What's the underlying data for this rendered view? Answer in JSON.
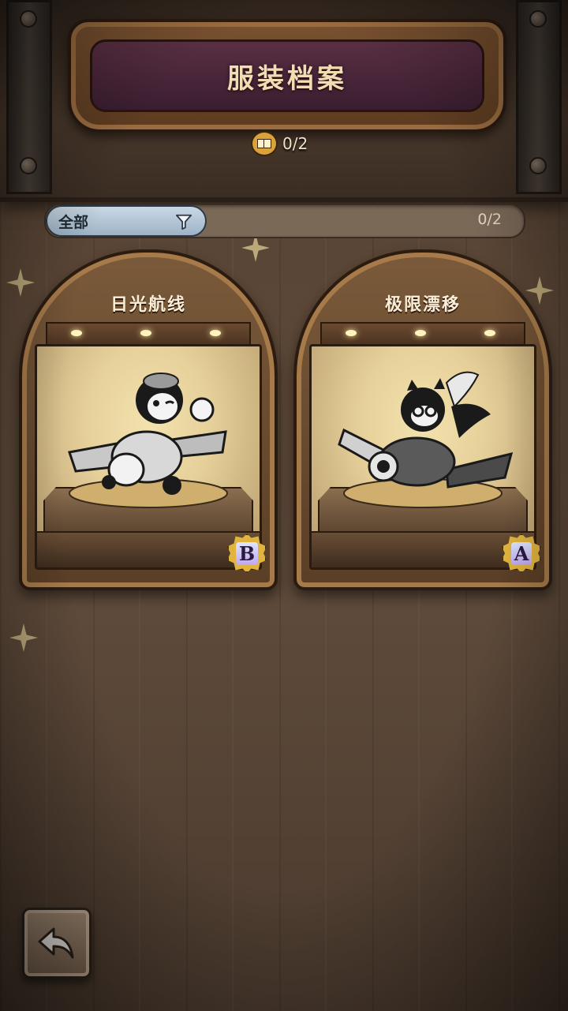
{
  "header": {
    "title": "服装档案",
    "collection_count": "0/2"
  },
  "filter": {
    "selected": "全部",
    "count": "0/2"
  },
  "costumes": [
    {
      "name": "日光航线",
      "rank": "B"
    },
    {
      "name": "极限漂移",
      "rank": "A"
    }
  ],
  "icons": {
    "collection": "book-icon",
    "filter": "funnel-icon",
    "back": "back-arrow-icon"
  },
  "colors": {
    "title_text": "#f3dcb4",
    "filter_chip": "#b3c6d6",
    "rank_badge": "#e0b43e"
  }
}
